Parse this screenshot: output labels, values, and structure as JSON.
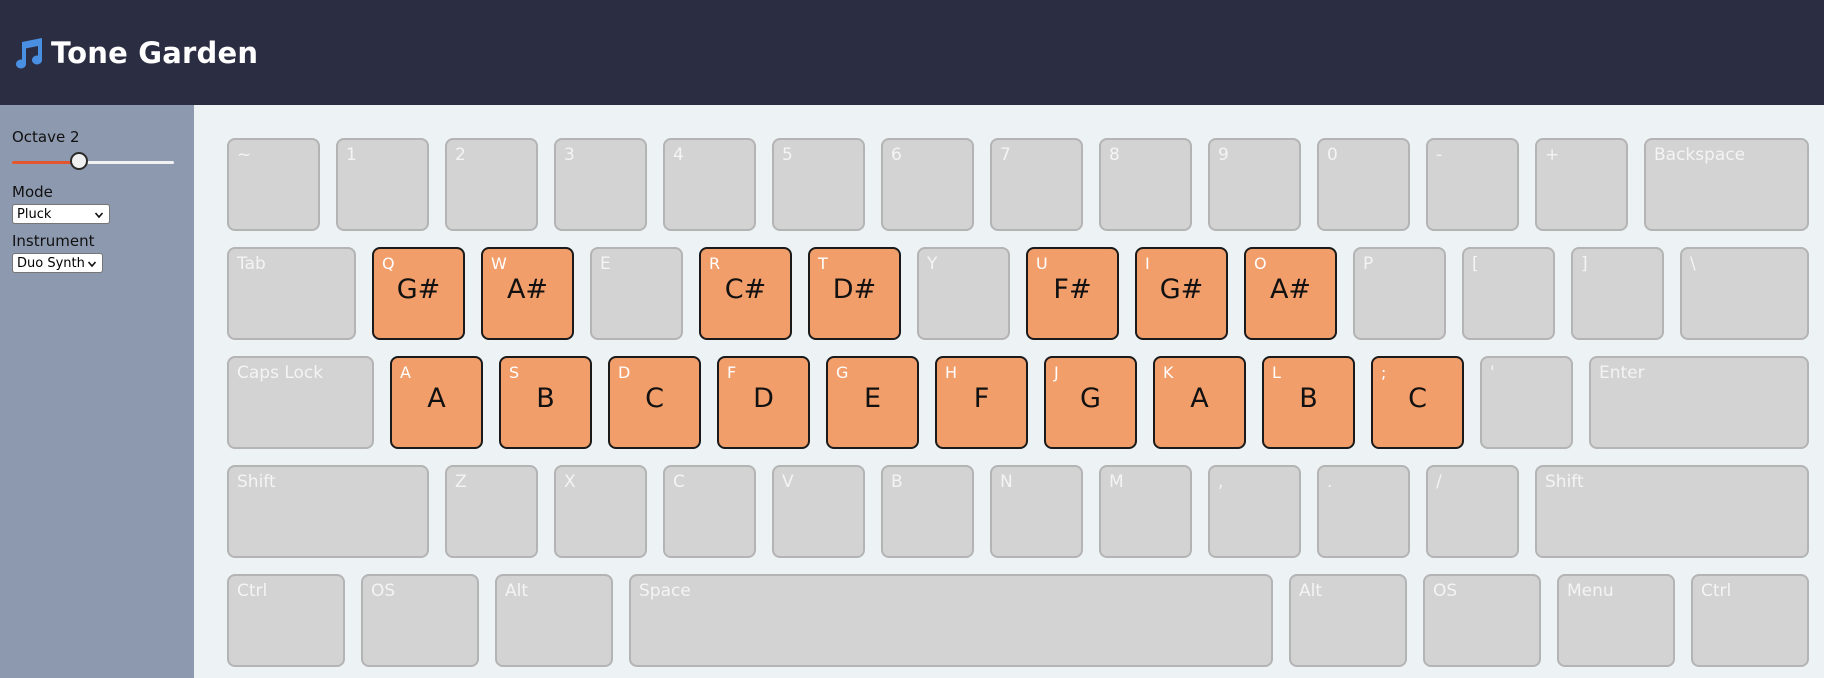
{
  "header": {
    "title": "Tone Garden",
    "icon": "music-note-icon",
    "bg": "#2b2d42",
    "logo_color": "#4a90e2"
  },
  "sidebar": {
    "octave_label": "Octave 2",
    "octave_value": 2,
    "octave_fraction": 0.4,
    "mode_label": "Mode",
    "mode_value": "Pluck",
    "instrument_label": "Instrument",
    "instrument_value": "Duo Synth"
  },
  "colors": {
    "key": "#d3d3d3",
    "note_key": "#f29e6a",
    "slider_fill": "#e4572e"
  },
  "rows": [
    [
      {
        "label": "~"
      },
      {
        "label": "1"
      },
      {
        "label": "2"
      },
      {
        "label": "3"
      },
      {
        "label": "4"
      },
      {
        "label": "5"
      },
      {
        "label": "6"
      },
      {
        "label": "7"
      },
      {
        "label": "8"
      },
      {
        "label": "9"
      },
      {
        "label": "0"
      },
      {
        "label": "-"
      },
      {
        "label": "+"
      },
      {
        "label": "Backspace"
      }
    ],
    [
      {
        "label": "Tab"
      },
      {
        "label": "Q",
        "note": "G#"
      },
      {
        "label": "W",
        "note": "A#"
      },
      {
        "label": "E"
      },
      {
        "label": "R",
        "note": "C#"
      },
      {
        "label": "T",
        "note": "D#"
      },
      {
        "label": "Y"
      },
      {
        "label": "U",
        "note": "F#"
      },
      {
        "label": "I",
        "note": "G#"
      },
      {
        "label": "O",
        "note": "A#"
      },
      {
        "label": "P"
      },
      {
        "label": "["
      },
      {
        "label": "]"
      },
      {
        "label": "\\"
      }
    ],
    [
      {
        "label": "Caps Lock"
      },
      {
        "label": "A",
        "note": "A"
      },
      {
        "label": "S",
        "note": "B"
      },
      {
        "label": "D",
        "note": "C"
      },
      {
        "label": "F",
        "note": "D"
      },
      {
        "label": "G",
        "note": "E"
      },
      {
        "label": "H",
        "note": "F"
      },
      {
        "label": "J",
        "note": "G"
      },
      {
        "label": "K",
        "note": "A"
      },
      {
        "label": "L",
        "note": "B"
      },
      {
        "label": ";",
        "note": "C"
      },
      {
        "label": "'"
      },
      {
        "label": "Enter"
      }
    ],
    [
      {
        "label": "Shift"
      },
      {
        "label": "Z"
      },
      {
        "label": "X"
      },
      {
        "label": "C"
      },
      {
        "label": "V"
      },
      {
        "label": "B"
      },
      {
        "label": "N"
      },
      {
        "label": "M"
      },
      {
        "label": ","
      },
      {
        "label": "."
      },
      {
        "label": "/"
      },
      {
        "label": "Shift"
      }
    ],
    [
      {
        "label": "Ctrl"
      },
      {
        "label": "OS"
      },
      {
        "label": "Alt"
      },
      {
        "label": "Space"
      },
      {
        "label": "Alt"
      },
      {
        "label": "OS"
      },
      {
        "label": "Menu"
      },
      {
        "label": "Ctrl"
      }
    ]
  ]
}
